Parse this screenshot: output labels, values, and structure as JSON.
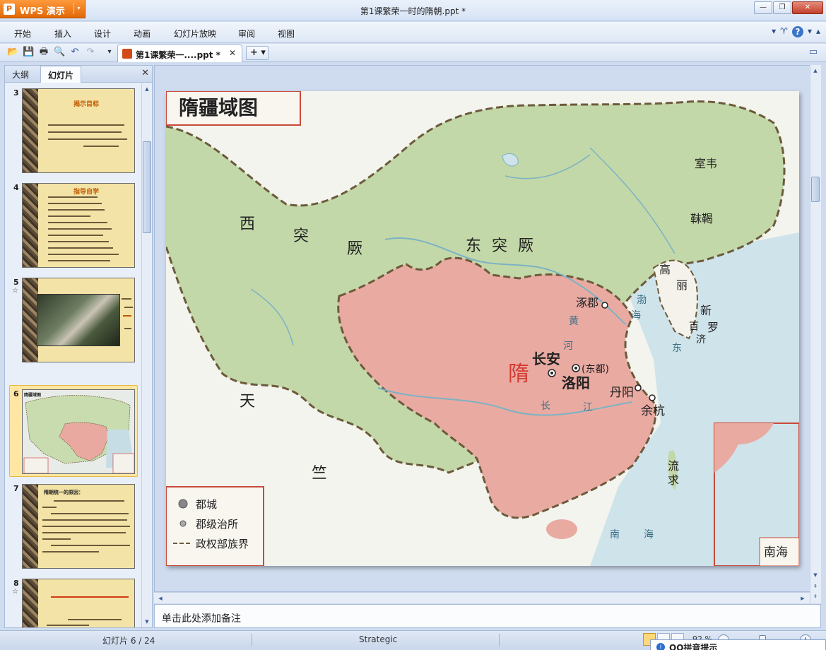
{
  "app": {
    "name": "WPS 演示",
    "logo": "P",
    "menu_arrow": "▾"
  },
  "window": {
    "title": "第1课繁荣一时的隋朝.ppt *",
    "minimize": "—",
    "restore": "❐",
    "close": "✕"
  },
  "menu": [
    "开始",
    "插入",
    "设计",
    "动画",
    "幻灯片放映",
    "审阅",
    "视图"
  ],
  "menu_right": {
    "options": "▾",
    "theme": "♈",
    "help": "?",
    "help_arrow": "▾",
    "collapse": "▴"
  },
  "quick_toolbar": {
    "open": "📂",
    "save": "💾",
    "print": "🖶",
    "preview": "🔍",
    "undo": "↶",
    "redo": "↷",
    "more": "▾"
  },
  "doc_tab": {
    "label": "第1课繁荣一....ppt *",
    "close": "✕",
    "new": "+ ▾"
  },
  "left_panel": {
    "tabs": [
      "大纲",
      "幻灯片"
    ],
    "close": "✕",
    "slides": [
      {
        "num": "3",
        "star": "",
        "title": "揭示目标"
      },
      {
        "num": "4",
        "star": "",
        "title": "指导自学"
      },
      {
        "num": "5",
        "star": "☆",
        "title": ""
      },
      {
        "num": "6",
        "star": "",
        "title": "隋疆域图"
      },
      {
        "num": "7",
        "star": "",
        "title": "隋朝统一的原因："
      },
      {
        "num": "8",
        "star": "☆",
        "title": ""
      }
    ]
  },
  "map": {
    "title": "隋疆域图",
    "regions": {
      "west_turks": [
        "西",
        "突",
        "厥"
      ],
      "east_turks": "东 突 厥",
      "sui": "隋",
      "tian": "天",
      "zhu": "竺",
      "goguryeo": [
        "高",
        "丽"
      ],
      "silla": [
        "新",
        "罗"
      ],
      "baekje": [
        "百",
        "济"
      ],
      "mohe": "靺鞨",
      "shiwei": "室韦",
      "liuqiu": [
        "流",
        "求"
      ]
    },
    "cities": {
      "zhuojun": "涿郡",
      "changan": "长安",
      "luoyang": "洛阳",
      "dongdu": "(东都)",
      "danyang": "丹阳",
      "yuhang": "余杭"
    },
    "water": {
      "he": "河",
      "huang": "黄",
      "jiang": "江",
      "chang": "长",
      "dong": "东",
      "hai1": "海",
      "nan": "南",
      "hai2": "海",
      "bo": "渤"
    },
    "inset_label": "南海",
    "legend": [
      "都城",
      "郡级治所",
      "政权部族界"
    ]
  },
  "notes_placeholder": "单击此处添加备注",
  "status": {
    "slide_info": "幻灯片 6 / 24",
    "theme": "Strategic",
    "zoom": "92 %",
    "zoom_minus": "−",
    "zoom_plus": "+",
    "zoom_level": 0.5
  },
  "popup": {
    "icon": "i",
    "title": "QQ拼音提示"
  }
}
